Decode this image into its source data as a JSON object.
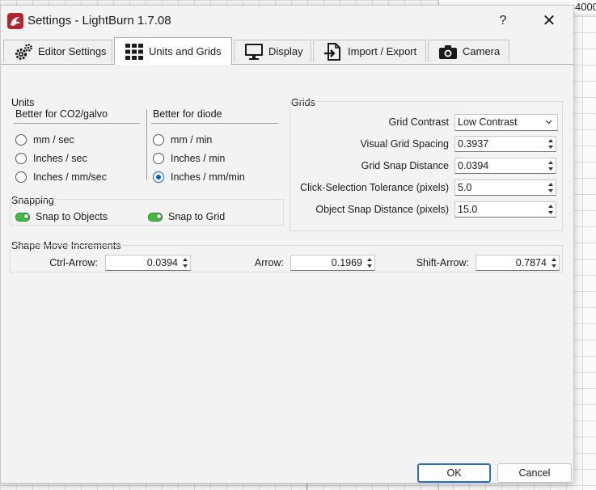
{
  "background": {
    "ruler_number": "4000"
  },
  "window": {
    "title": "Settings - LightBurn 1.7.08",
    "help": "?",
    "close": "✕"
  },
  "tabs": [
    {
      "label": "Editor Settings",
      "icon": "gears-icon"
    },
    {
      "label": "Units and Grids",
      "icon": "grid-icon",
      "active": true
    },
    {
      "label": "Display",
      "icon": "monitor-icon"
    },
    {
      "label": "Import / Export",
      "icon": "file-import-icon"
    },
    {
      "label": "Camera",
      "icon": "camera-icon"
    }
  ],
  "units": {
    "title": "Units",
    "co2": {
      "header": "Better for CO2/galvo",
      "options": [
        "mm / sec",
        "Inches / sec",
        "Inches / mm/sec"
      ],
      "selected": -1
    },
    "diode": {
      "header": "Better for diode",
      "options": [
        "mm / min",
        "Inches / min",
        "Inches / mm/min"
      ],
      "selected": 2
    }
  },
  "snapping": {
    "title": "Snapping",
    "snap_objects": "Snap to Objects",
    "snap_grid": "Snap to Grid"
  },
  "grids": {
    "title": "Grids",
    "contrast_label": "Grid Contrast",
    "contrast_value": "Low Contrast",
    "spacing_label": "Visual Grid Spacing",
    "spacing_value": "0.3937",
    "snap_label": "Grid Snap Distance",
    "snap_value": "0.0394",
    "click_label": "Click-Selection Tolerance (pixels)",
    "click_value": "5.0",
    "obj_label": "Object Snap Distance (pixels)",
    "obj_value": "15.0"
  },
  "shape_move": {
    "title": "Shape Move Increments",
    "ctrl_label": "Ctrl-Arrow:",
    "ctrl_value": "0.0394",
    "arrow_label": "Arrow:",
    "arrow_value": "0.1969",
    "shift_label": "Shift-Arrow:",
    "shift_value": "0.7874"
  },
  "buttons": {
    "ok": "OK",
    "cancel": "Cancel"
  },
  "colors": {
    "accent": "#0a5fc8",
    "toggle_on": "#3fbf3f",
    "app_icon": "#b3262f"
  }
}
